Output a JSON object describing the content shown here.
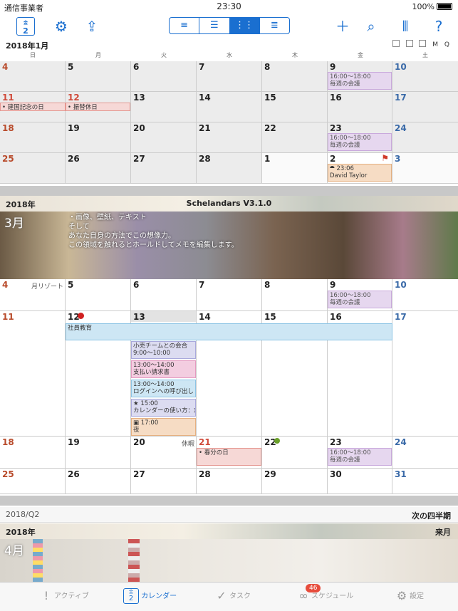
{
  "status_bar": {
    "carrier": "通信事業者",
    "time": "23:30",
    "battery": "100%"
  },
  "toolbar": {
    "today_day": "2",
    "today_weekday": "金",
    "view_modes": [
      "≡",
      "☰",
      "⋮⋮",
      "≣"
    ],
    "active_view": 2
  },
  "month1": {
    "title": "2018年1月",
    "weekdays": [
      "日",
      "月",
      "火",
      "水",
      "木",
      "金",
      "土"
    ],
    "view_mode_labels": [
      "M",
      "Q"
    ],
    "weeks": [
      {
        "days": [
          "4",
          "5",
          "6",
          "7",
          "8",
          "9",
          "10"
        ]
      },
      {
        "days": [
          "11",
          "12",
          "13",
          "14",
          "15",
          "16",
          "17"
        ]
      },
      {
        "days": [
          "18",
          "19",
          "20",
          "21",
          "22",
          "23",
          "24"
        ]
      },
      {
        "days": [
          "25",
          "26",
          "27",
          "28",
          "1",
          "2",
          "3"
        ]
      }
    ],
    "events": {
      "w1_fri": "16:00〜18:00",
      "w1_fri_2": "毎週の会議",
      "w2_sun": "建国記念の日",
      "w2_mon": "振替休日",
      "w3_fri": "16:00〜18:00",
      "w3_fri_2": "毎週の会議",
      "w4_fri": "23:06",
      "w4_fri_2": "David Taylor"
    }
  },
  "band1": {
    "year": "2018年",
    "app": "Schelandars V3.1.0"
  },
  "march": {
    "label": "3月",
    "memo": [
      "・画像、壁紙、テキスト",
      "そして",
      "あなた自身の方法でこの想像力。",
      "この領域を触れるとホールドしてメモを編集します。"
    ],
    "weeks": [
      {
        "days": [
          "4",
          "5",
          "6",
          "7",
          "8",
          "9",
          "10"
        ],
        "note": "月リゾート"
      },
      {
        "days": [
          "11",
          "12",
          "13",
          "14",
          "15",
          "16",
          "17"
        ]
      },
      {
        "days": [
          "18",
          "19",
          "20",
          "21",
          "22",
          "23",
          "24"
        ],
        "note": "休暇"
      },
      {
        "days": [
          "25",
          "26",
          "27",
          "28",
          "29",
          "30",
          "31"
        ]
      }
    ],
    "events": {
      "w1_fri": "16:00〜18:00",
      "w1_fri_2": "毎週の会議",
      "span": "社員教育",
      "e1": "小売チームとの会合",
      "e1b": "9:00〜10:00",
      "e2": "13:00〜14:00",
      "e2b": "支払い請求書",
      "e3": "13:00〜14:00",
      "e3b": "ログインへの呼び出し",
      "e4": "15:00",
      "e4b": "カレンダーの使い方：ﾇ",
      "e5": "17:00",
      "e5b": "夜",
      "w3_wed": "春分の日",
      "w3_fri": "16:00〜18:00",
      "w3_fri_2": "毎週の会議"
    }
  },
  "quarter": {
    "left": "2018/Q2",
    "right": "次の四半期"
  },
  "band2": {
    "year": "2018年",
    "right": "来月"
  },
  "april": {
    "label": "4月"
  },
  "tabbar": {
    "items": [
      {
        "label": "アクティブ"
      },
      {
        "label": "カレンダー",
        "day": "2",
        "weekday": "金"
      },
      {
        "label": "タスク"
      },
      {
        "label": "スケジュール",
        "badge": "46"
      },
      {
        "label": "設定"
      }
    ]
  }
}
